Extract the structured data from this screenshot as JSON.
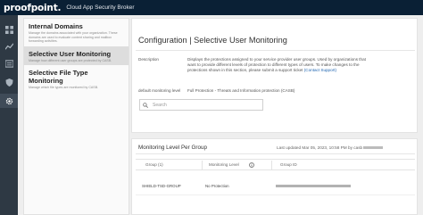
{
  "header": {
    "logo": "proofpoint.",
    "app_title": "Cloud App Security Broker"
  },
  "rail": {
    "items": [
      "dashboard-icon",
      "chart-icon",
      "list-icon",
      "shield-icon",
      "gear-icon"
    ],
    "active_index": 4
  },
  "sidenav": {
    "items": [
      {
        "title": "Internal Domains",
        "desc": "Manage the domains associated with your organization. These domains are used to evaluate content sharing and mailbox forwarding activities."
      },
      {
        "title": "Selective User Monitoring",
        "desc": "Manage how different user groups are protected by CASB."
      },
      {
        "title": "Selective File Type Monitoring",
        "desc": "Manage which file types are monitored by CASB."
      }
    ],
    "active_index": 1
  },
  "main": {
    "title": "Configuration | Selective User Monitoring",
    "description_label": "Description",
    "description_text": "Displays the protections assigned to your service provider user groups. Used by organizations that want to provide different levels of protection to different types of users. To make changes to the protections shown in this section, please submit a support ticket",
    "description_link": "(Contact Support)",
    "default_level_label": "default monitoring level",
    "default_level_value": "Full Protection - Threats and Information protection (CASB)",
    "search_placeholder": "Search"
  },
  "table": {
    "title": "Monitoring Level Per Group",
    "last_updated": "Last updated Mar 05, 2023, 10:58 PM by casb",
    "columns": [
      "Group (1)",
      "Monitoring Level",
      "Group ID"
    ],
    "rows": [
      {
        "group": "SHIELD-TSD-GROUP",
        "level": "No Protection"
      }
    ]
  }
}
